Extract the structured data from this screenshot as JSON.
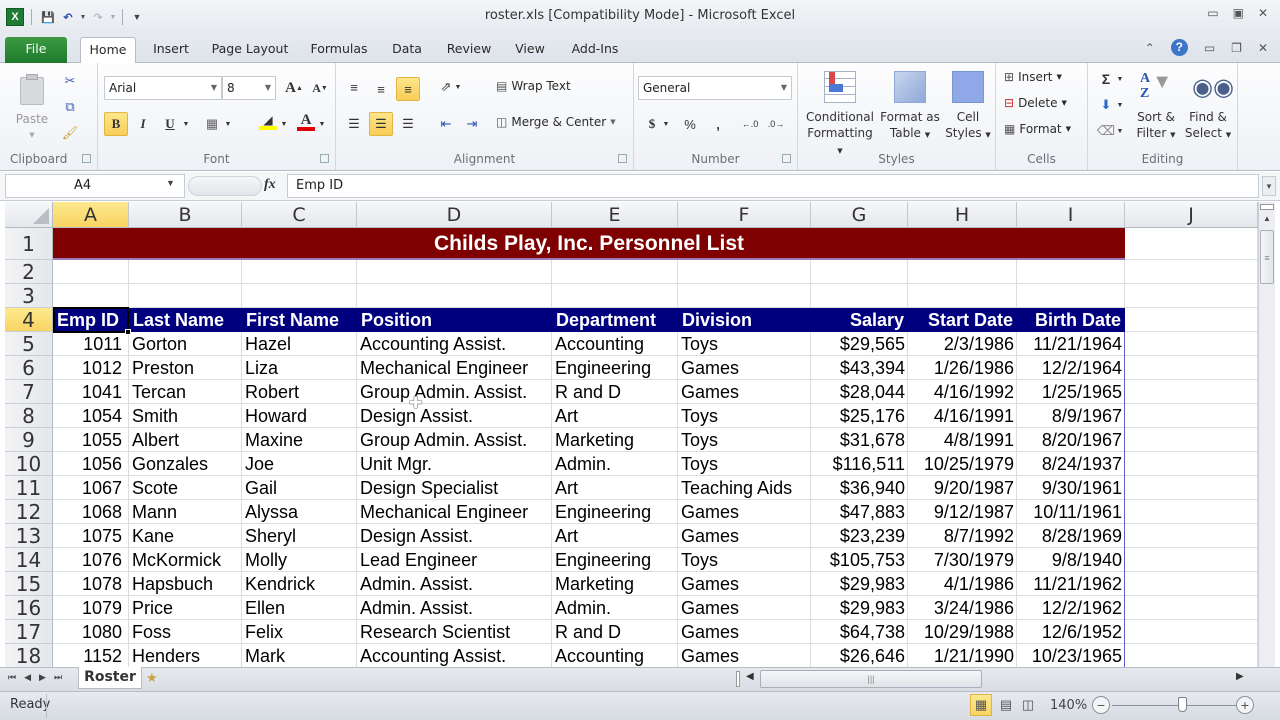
{
  "window": {
    "title": "roster.xls  [Compatibility Mode]  -  Microsoft Excel",
    "app_icon": "excel-icon"
  },
  "qat": {
    "items": [
      "save-icon",
      "undo-icon",
      "redo-icon",
      "customize-qat-icon"
    ]
  },
  "tabs": [
    {
      "label": "File"
    },
    {
      "label": "Home"
    },
    {
      "label": "Insert"
    },
    {
      "label": "Page Layout"
    },
    {
      "label": "Formulas"
    },
    {
      "label": "Data"
    },
    {
      "label": "Review"
    },
    {
      "label": "View"
    },
    {
      "label": "Add-Ins"
    }
  ],
  "ribbon": {
    "clipboard": {
      "label": "Clipboard",
      "paste": "Paste"
    },
    "font": {
      "label": "Font",
      "name": "Arial",
      "size": "8",
      "bold": "B",
      "italic": "I",
      "underline": "U",
      "fill_color": "#ffff00",
      "font_color": "#e00000"
    },
    "alignment": {
      "label": "Alignment",
      "wrap_text": "Wrap Text",
      "merge_center": "Merge & Center"
    },
    "number": {
      "label": "Number",
      "format": "General",
      "currency": "$",
      "percent": "%",
      "comma": ","
    },
    "styles": {
      "label": "Styles",
      "conditional": [
        "Conditional",
        "Formatting"
      ],
      "format_table": [
        "Format as",
        "Table"
      ],
      "cell_styles": [
        "Cell",
        "Styles"
      ]
    },
    "cells": {
      "label": "Cells",
      "insert": "Insert",
      "delete": "Delete",
      "format": "Format"
    },
    "editing": {
      "label": "Editing",
      "sort_filter": [
        "Sort &",
        "Filter"
      ],
      "find_select": [
        "Find &",
        "Select"
      ],
      "sigma": "Σ"
    }
  },
  "formula_bar": {
    "name_box": "A4",
    "fx": "fx",
    "content": "Emp ID"
  },
  "columns": [
    "A",
    "B",
    "C",
    "D",
    "E",
    "F",
    "G",
    "H",
    "I",
    "J"
  ],
  "rows": [
    "1",
    "2",
    "3",
    "4",
    "5",
    "6",
    "7",
    "8",
    "9",
    "10",
    "11",
    "12",
    "13",
    "14",
    "15",
    "16",
    "17",
    "18"
  ],
  "sheet": {
    "title": "Childs Play, Inc. Personnel List",
    "title_bg": "#7e0000",
    "header_bg": "#00007e",
    "headers": [
      "Emp ID",
      "Last Name",
      "First Name",
      "Position",
      "Department",
      "Division",
      "Salary",
      "Start Date",
      "Birth Date"
    ],
    "data": [
      [
        "1011",
        "Gorton",
        "Hazel",
        "Accounting Assist.",
        "Accounting",
        "Toys",
        "$29,565",
        "2/3/1986",
        "11/21/1964"
      ],
      [
        "1012",
        "Preston",
        "Liza",
        "Mechanical Engineer",
        "Engineering",
        "Games",
        "$43,394",
        "1/26/1986",
        "12/2/1964"
      ],
      [
        "1041",
        "Tercan",
        "Robert",
        "Group Admin. Assist.",
        "R and D",
        "Games",
        "$28,044",
        "4/16/1992",
        "1/25/1965"
      ],
      [
        "1054",
        "Smith",
        "Howard",
        "Design Assist.",
        "Art",
        "Toys",
        "$25,176",
        "4/16/1991",
        "8/9/1967"
      ],
      [
        "1055",
        "Albert",
        "Maxine",
        "Group Admin. Assist.",
        "Marketing",
        "Toys",
        "$31,678",
        "4/8/1991",
        "8/20/1967"
      ],
      [
        "1056",
        "Gonzales",
        "Joe",
        "Unit Mgr.",
        "Admin.",
        "Toys",
        "$116,511",
        "10/25/1979",
        "8/24/1937"
      ],
      [
        "1067",
        "Scote",
        "Gail",
        "Design Specialist",
        "Art",
        "Teaching Aids",
        "$36,940",
        "9/20/1987",
        "9/30/1961"
      ],
      [
        "1068",
        "Mann",
        "Alyssa",
        "Mechanical Engineer",
        "Engineering",
        "Games",
        "$47,883",
        "9/12/1987",
        "10/11/1961"
      ],
      [
        "1075",
        "Kane",
        "Sheryl",
        "Design Assist.",
        "Art",
        "Games",
        "$23,239",
        "8/7/1992",
        "8/28/1969"
      ],
      [
        "1076",
        "McKormick",
        "Molly",
        "Lead Engineer",
        "Engineering",
        "Toys",
        "$105,753",
        "7/30/1979",
        "9/8/1940"
      ],
      [
        "1078",
        "Hapsbuch",
        "Kendrick",
        "Admin. Assist.",
        "Marketing",
        "Games",
        "$29,983",
        "4/1/1986",
        "11/21/1962"
      ],
      [
        "1079",
        "Price",
        "Ellen",
        "Admin. Assist.",
        "Admin.",
        "Games",
        "$29,983",
        "3/24/1986",
        "12/2/1962"
      ],
      [
        "1080",
        "Foss",
        "Felix",
        "Research Scientist",
        "R and D",
        "Games",
        "$64,738",
        "10/29/1988",
        "12/6/1952"
      ],
      [
        "1152",
        "Henders",
        "Mark",
        "Accounting Assist.",
        "Accounting",
        "Games",
        "$26,646",
        "1/21/1990",
        "10/23/1965"
      ]
    ]
  },
  "sheet_tabs": [
    {
      "label": "Roster"
    }
  ],
  "status": {
    "text": "Ready",
    "zoom": "140%",
    "zoom_percent": 140
  }
}
